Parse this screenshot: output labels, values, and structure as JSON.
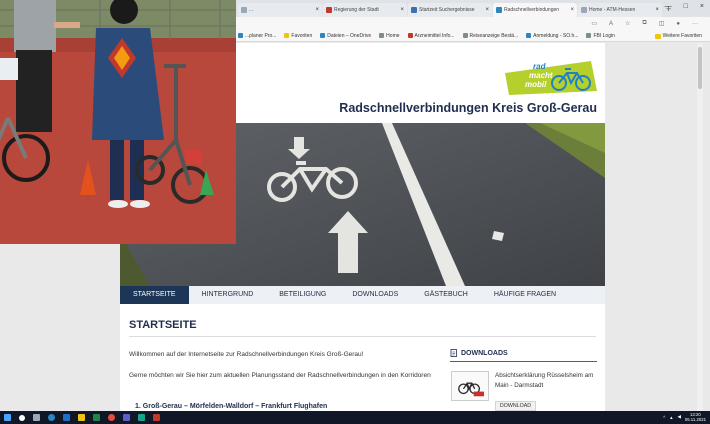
{
  "browser": {
    "tabs": [
      {
        "label": "...",
        "active": false,
        "color": "#9aa7b8"
      },
      {
        "label": "Regierung der Stadt",
        "active": false,
        "color": "#c0392b"
      },
      {
        "label": "Startzeit Suchergebnisse",
        "active": false,
        "color": "#3d6fb4"
      },
      {
        "label": "Radschnellverbindungen",
        "active": true,
        "color": "#2e86c1"
      },
      {
        "label": "Home - ATM-Hessen",
        "active": false,
        "color": "#9aa7b8"
      }
    ],
    "tab_close": "×",
    "new_tab": "+",
    "window_controls": [
      "—",
      "□",
      "×"
    ],
    "favorites": [
      {
        "label": "...planer Pro...",
        "color": "#2e86c1"
      },
      {
        "label": "Favoriten",
        "color": "#f1c40f"
      },
      {
        "label": "Dateien – OneDrive",
        "color": "#2e86c1"
      },
      {
        "label": "Home",
        "color": "#7f8c8d"
      },
      {
        "label": "Arzneimittel Info...",
        "color": "#c0392b"
      },
      {
        "label": "Reiseanzeige Bestä...",
        "color": "#7f8c8d"
      },
      {
        "label": "Anmeldung - SO.h...",
        "color": "#2e86c1"
      },
      {
        "label": "FBI Login",
        "color": "#7f8c8d"
      }
    ],
    "favorites_right": "Weitere Favoriten"
  },
  "site": {
    "logo_text": [
      "rad",
      "macht",
      "mobil"
    ],
    "title": "Radschnellverbindungen Kreis Groß-Gerau",
    "nav": [
      {
        "label": "STARTSEITE",
        "active": true
      },
      {
        "label": "HINTERGRUND",
        "active": false
      },
      {
        "label": "BETEILIGUNG",
        "active": false
      },
      {
        "label": "DOWNLOADS",
        "active": false
      },
      {
        "label": "GÄSTEBUCH",
        "active": false
      },
      {
        "label": "HÄUFIGE FRAGEN",
        "active": false
      }
    ],
    "content_title": "STARTSEITE",
    "welcome_text": "Willkommen auf der Internetseite zur Radschnellverbindungen Kreis Groß-Gerau!",
    "intro_text": "Gerne möchten wir Sie hier zum aktuellen Planungsstand der Radschnellverbindungen in den Korridoren",
    "list_item": "1. Groß-Gerau – Mörfelden-Walldorf – Frankfurt Flughafen",
    "downloads": {
      "heading": "DOWNLOADS",
      "item_text": "Absichtserklärung Rüsselsheim am Main - Darmstadt",
      "button": "DOWNLOAD"
    }
  },
  "colors": {
    "nav_active": "#1d3557",
    "title": "#1f2d4e",
    "logo_green": "#b5cf2d",
    "logo_blue": "#1f80c6",
    "downloads_rule": "#c9302c"
  },
  "taskbar": {
    "clock_time": "13:20",
    "clock_date": "05.11.2021"
  }
}
